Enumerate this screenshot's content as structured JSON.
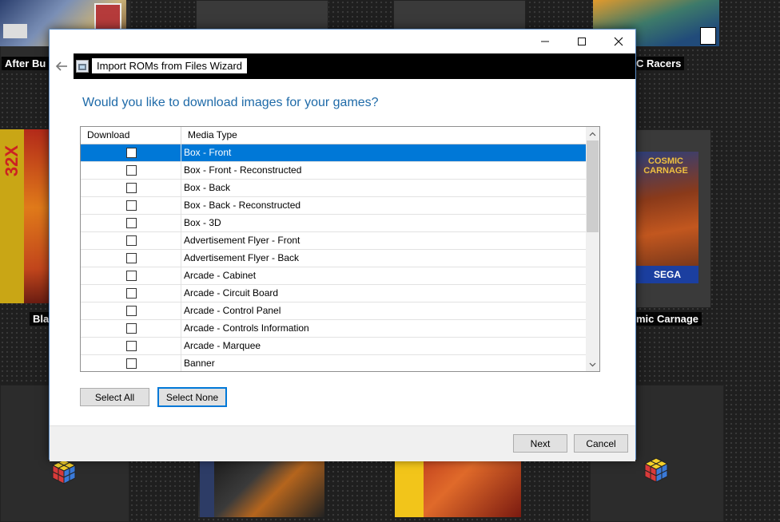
{
  "window": {
    "title": "Import ROMs from Files Wizard",
    "minimize_glyph": "—",
    "maximize_glyph": "☐",
    "close_glyph": "✕",
    "back_glyph": "←"
  },
  "background": {
    "games": [
      {
        "label": "After Bu"
      },
      {
        "label": "C Racers"
      },
      {
        "label": "Bla"
      },
      {
        "label": "mic Carnage"
      }
    ],
    "sega_logo": "SEGA",
    "x32_logo": "32X",
    "cosmic_title": "COSMIC CARNAGE"
  },
  "wizard": {
    "question": "Would you like to download images for your games?",
    "columns": [
      "Download",
      "Media Type"
    ],
    "rows": [
      {
        "media_type": "Box - Front",
        "checked": false,
        "selected": true
      },
      {
        "media_type": "Box - Front - Reconstructed",
        "checked": false,
        "selected": false
      },
      {
        "media_type": "Box - Back",
        "checked": false,
        "selected": false
      },
      {
        "media_type": "Box - Back - Reconstructed",
        "checked": false,
        "selected": false
      },
      {
        "media_type": "Box - 3D",
        "checked": false,
        "selected": false
      },
      {
        "media_type": "Advertisement Flyer - Front",
        "checked": false,
        "selected": false
      },
      {
        "media_type": "Advertisement Flyer - Back",
        "checked": false,
        "selected": false
      },
      {
        "media_type": "Arcade - Cabinet",
        "checked": false,
        "selected": false
      },
      {
        "media_type": "Arcade - Circuit Board",
        "checked": false,
        "selected": false
      },
      {
        "media_type": "Arcade - Control Panel",
        "checked": false,
        "selected": false
      },
      {
        "media_type": "Arcade - Controls Information",
        "checked": false,
        "selected": false
      },
      {
        "media_type": "Arcade - Marquee",
        "checked": false,
        "selected": false
      },
      {
        "media_type": "Banner",
        "checked": false,
        "selected": false
      }
    ],
    "select_all_label": "Select All",
    "select_none_label": "Select None",
    "next_label": "Next",
    "cancel_label": "Cancel"
  },
  "colors": {
    "accent": "#0078d7",
    "question_text": "#1e6aa8"
  }
}
